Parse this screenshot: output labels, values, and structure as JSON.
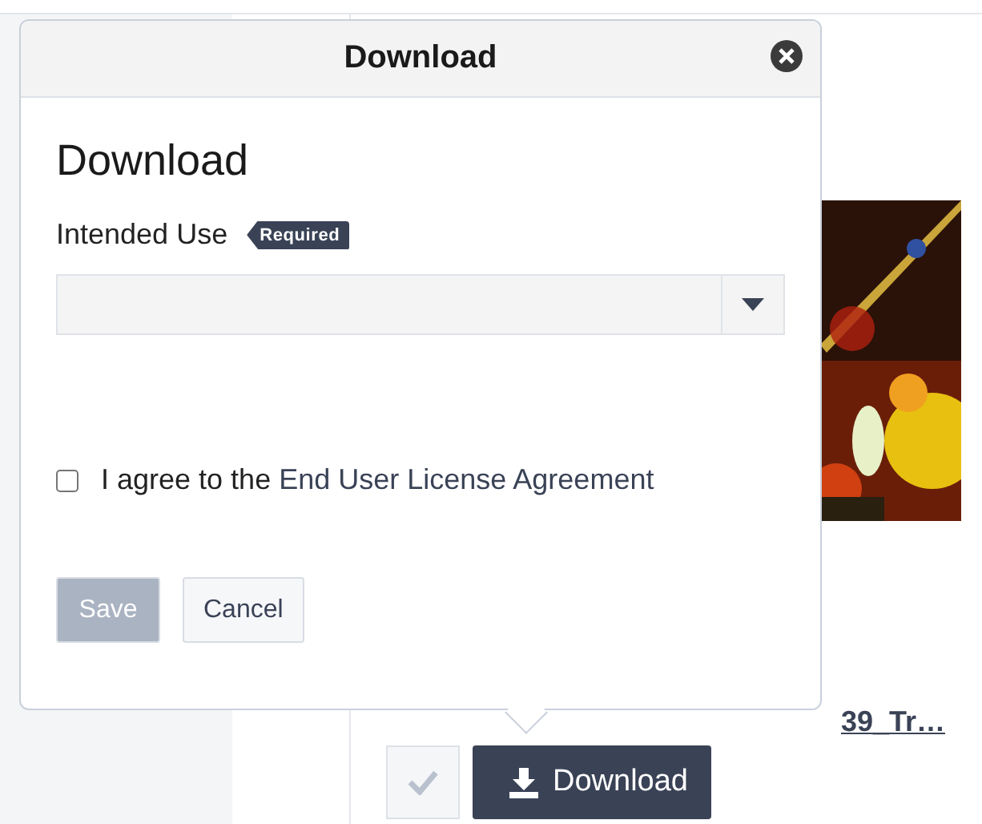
{
  "dialog": {
    "title": "Download",
    "heading": "Download",
    "field_label": "Intended Use",
    "required_badge": "Required",
    "agreement": {
      "checked": false,
      "text": "I agree to the ",
      "link": "End User License Agreement"
    },
    "buttons": [
      {
        "label": "Save",
        "disabled": true
      },
      {
        "label": "Cancel",
        "disabled": false
      }
    ]
  },
  "asset": {
    "kind": "picture",
    "filename": "39_Tr…",
    "selected": false,
    "download_button": "Download"
  }
}
